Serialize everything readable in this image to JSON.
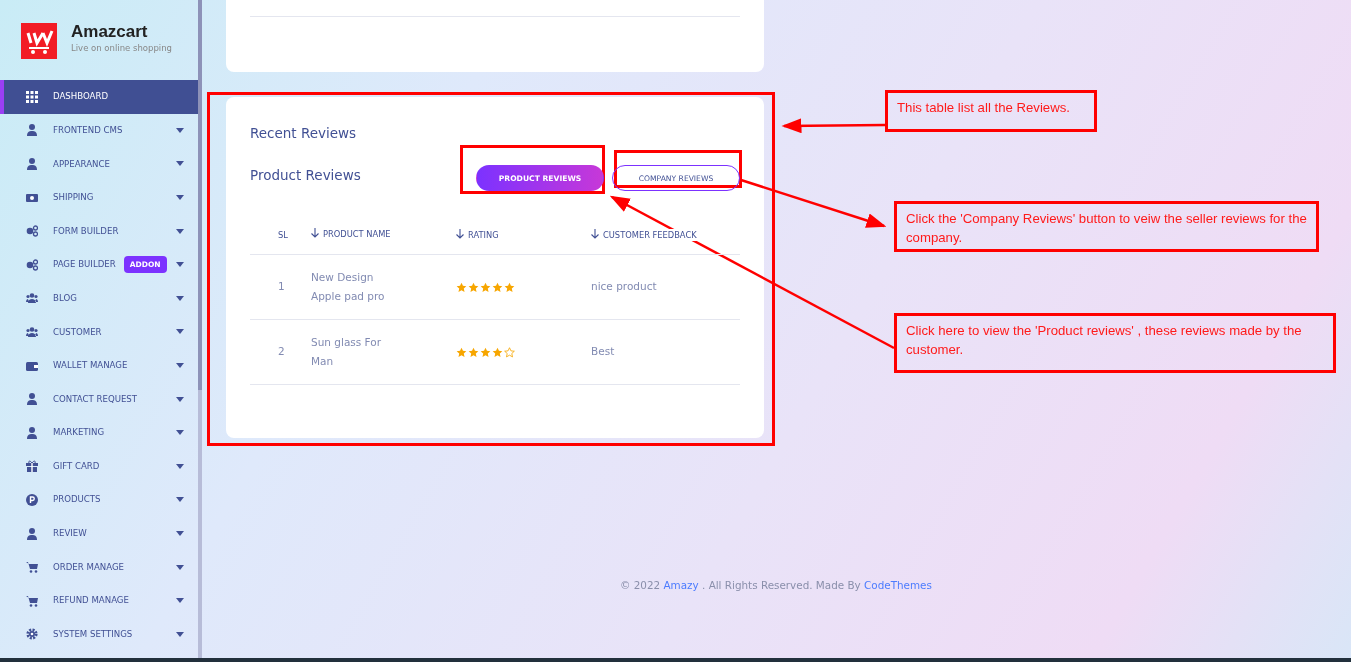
{
  "brand": {
    "name": "Amazcart",
    "tagline": "Live on online shopping"
  },
  "sidebar": {
    "items": [
      {
        "label": "DASHBOARD",
        "selected": true,
        "caret": false
      },
      {
        "label": "FRONTEND CMS",
        "selected": false,
        "caret": true
      },
      {
        "label": "APPEARANCE",
        "selected": false,
        "caret": true
      },
      {
        "label": "SHIPPING",
        "selected": false,
        "caret": true
      },
      {
        "label": "FORM BUILDER",
        "selected": false,
        "caret": true
      },
      {
        "label": "PAGE BUILDER",
        "selected": false,
        "caret": true,
        "badge": "ADDON"
      },
      {
        "label": "BLOG",
        "selected": false,
        "caret": true
      },
      {
        "label": "CUSTOMER",
        "selected": false,
        "caret": true
      },
      {
        "label": "WALLET MANAGE",
        "selected": false,
        "caret": true
      },
      {
        "label": "CONTACT REQUEST",
        "selected": false,
        "caret": true
      },
      {
        "label": "MARKETING",
        "selected": false,
        "caret": true
      },
      {
        "label": "GIFT CARD",
        "selected": false,
        "caret": true
      },
      {
        "label": "PRODUCTS",
        "selected": false,
        "caret": true
      },
      {
        "label": "REVIEW",
        "selected": false,
        "caret": true
      },
      {
        "label": "ORDER MANAGE",
        "selected": false,
        "caret": true
      },
      {
        "label": "REFUND MANAGE",
        "selected": false,
        "caret": true
      },
      {
        "label": "SYSTEM SETTINGS",
        "selected": false,
        "caret": true
      }
    ]
  },
  "card": {
    "title": "Recent Reviews",
    "subtitle": "Product Reviews",
    "tabs": [
      {
        "label": "PRODUCT REVIEWS",
        "selected": true
      },
      {
        "label": "COMPANY REVIEWS",
        "selected": false
      }
    ],
    "columns": [
      {
        "label": "SL",
        "sort_arrow": false
      },
      {
        "label": "PRODUCT NAME",
        "sort_arrow": true
      },
      {
        "label": "RATING",
        "sort_arrow": true
      },
      {
        "label": "CUSTOMER FEEDBACK",
        "sort_arrow": true
      }
    ],
    "rows": [
      {
        "sl": "1",
        "product_name": "New Design Apple pad pro",
        "stars": 5,
        "feedback": "nice product"
      },
      {
        "sl": "2",
        "product_name": "Sun glass For Man",
        "stars": 4,
        "feedback": "Best"
      }
    ]
  },
  "footer": {
    "parts": [
      {
        "kind": "text",
        "text": "© 2022 "
      },
      {
        "kind": "link",
        "text": "Amazy"
      },
      {
        "kind": "text",
        "text": " . All Rights Reserved. Made By "
      },
      {
        "kind": "link",
        "text": "CodeThemes"
      }
    ]
  },
  "annotations": [
    {
      "text": "This table list all the Reviews."
    },
    {
      "text": "Click the 'Company Reviews' button to veiw the seller reviews for the company."
    },
    {
      "text": "Click here to view the 'Product reviews' , these reviews made by the customer."
    }
  ]
}
